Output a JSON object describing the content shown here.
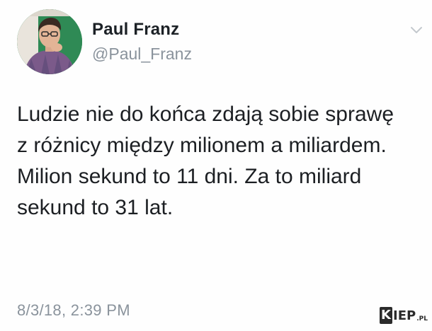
{
  "author": {
    "display_name": "Paul Franz",
    "handle": "@Paul_Franz",
    "avatar_icon": "profile-photo"
  },
  "menu": {
    "icon": "chevron-down-icon",
    "color": "#c4c9ce"
  },
  "tweet": {
    "lines": [
      "Ludzie nie do końca zdają sobie sprawę",
      "z różnicy między milionem a miliardem.",
      "Milion sekund to 11 dni. Za to miliard",
      "sekund to 31 lat."
    ],
    "timestamp": "8/3/18, 2:39 PM"
  },
  "watermark": {
    "k": "K",
    "rest": "IEP",
    "tld": ".PL"
  },
  "colors": {
    "name": "#1c2126",
    "secondary": "#8a939c",
    "text": "#1c1f23",
    "avatar_bg": "#2f8a55"
  }
}
